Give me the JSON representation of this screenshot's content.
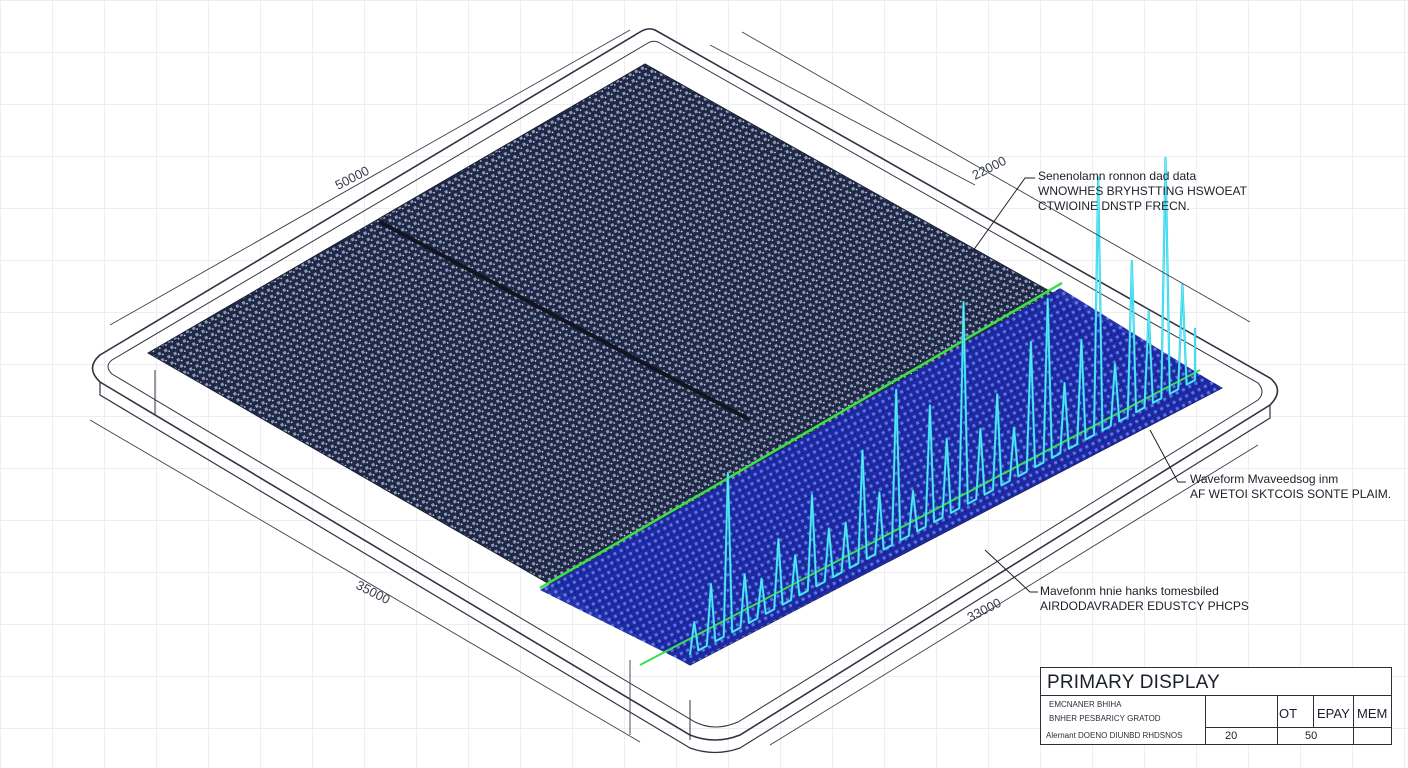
{
  "dimensions": {
    "top_left": "50000",
    "top_right": "22000",
    "bottom_left": "35000",
    "bottom_right": "33000"
  },
  "annotations": {
    "note1": [
      "Senenolamn ronnon dad data",
      "WNOWHES BRYHSTTING HSWOEAT",
      "CTWIOINE DNSTP FRECN."
    ],
    "note2": [
      "Waveform Mvaveedsog inm",
      "AF WETOI SKTCOIS SONTE PLAIM."
    ],
    "note3": [
      "Mavefonm hnie hanks tomesbiled",
      "AIRDODAVRADER EDUSTCY PHCPS"
    ]
  },
  "title_block": {
    "title": "PRIMARY DISPLAY",
    "row1": "EMCNANER BHIHA",
    "row2": "BNHER PESBARICY GRATOD",
    "row3": "Alernant DOENO DIUNBD RHDSNOS",
    "col1_header": "OT",
    "col2_header": "EPAY",
    "col3_header": "MEM",
    "val1": "20",
    "val2": "50"
  },
  "colors": {
    "grid_dark": "#1f2845",
    "waveform_region": "#1d2aa8",
    "waveform_line": "#2bd3e8",
    "baseline": "#39e04a",
    "outline": "#2f3440"
  },
  "waveform_data": {
    "peaks": [
      0.18,
      0.35,
      0.95,
      0.3,
      0.22,
      0.4,
      0.25,
      0.55,
      0.3,
      0.28,
      0.65,
      0.35,
      0.9,
      0.25,
      0.7,
      0.45,
      1.2,
      0.4,
      0.55,
      0.3,
      0.75,
      0.95,
      0.4,
      0.6,
      1.5,
      0.35,
      0.9,
      0.55,
      1.4,
      0.6,
      0.3
    ]
  }
}
